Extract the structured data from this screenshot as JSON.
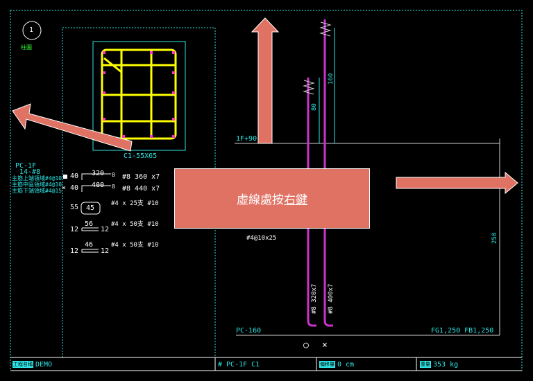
{
  "badge": {
    "number": "1",
    "caption": "柱圖"
  },
  "beam_section": {
    "label": "C1-55X65"
  },
  "left_legend": {
    "code": "PC-1F",
    "sub": "14-#8",
    "rows": [
      "主筋上端領域#4@10",
      "主筋中區領域#4@10",
      "主筋下端領域#4@15"
    ]
  },
  "rebar_schedule": [
    {
      "prefix": "■",
      "left_num": "40",
      "top_num": "320",
      "side_num": "8",
      "spec": "#8 360 x7"
    },
    {
      "prefix": "×",
      "left_num": "40",
      "top_num": "400",
      "side_num": "8",
      "spec": "#8 440 x7"
    },
    {
      "prefix": "",
      "left_num": "55",
      "top_num": "45",
      "side_num": "",
      "spec": "#4 x 25支 #10"
    },
    {
      "prefix": "",
      "left_num": "12",
      "top_num": "56",
      "side_num": "12",
      "spec": "#4 x 50支 #10"
    },
    {
      "prefix": "",
      "left_num": "12",
      "top_num": "46",
      "side_num": "12",
      "spec": "#4 x 50支 #10"
    }
  ],
  "elevation": {
    "level_label": "1F+90",
    "dim_80": "80",
    "dim_160": "160",
    "dim_250": "250",
    "stirrup_text": "#4@10x25",
    "bar1_text": "#8 320x7",
    "bar2_text": "#8 400x7",
    "pc_label": "PC-160",
    "fg_label": "FG1,250 FB1,250"
  },
  "toolbar_symbols": {
    "circle": "○",
    "cross": "×"
  },
  "status_bar": {
    "project_tag": "工程名稱",
    "project_name": "DEMO",
    "element_id": "# PC-1F C1",
    "offset_tag": "偏移量",
    "offset_value": "0 cm",
    "weight_tag": "重量",
    "weight_value": "353 kg"
  },
  "overlay": {
    "text_before": "虛線處按",
    "text_underlined": "右鍵"
  },
  "colors": {
    "background": "#000000",
    "dim_line": "#2fe6e6",
    "rebar": "#ffff00",
    "bar_elev": "#cc33cc",
    "overlay": "#e07264"
  }
}
